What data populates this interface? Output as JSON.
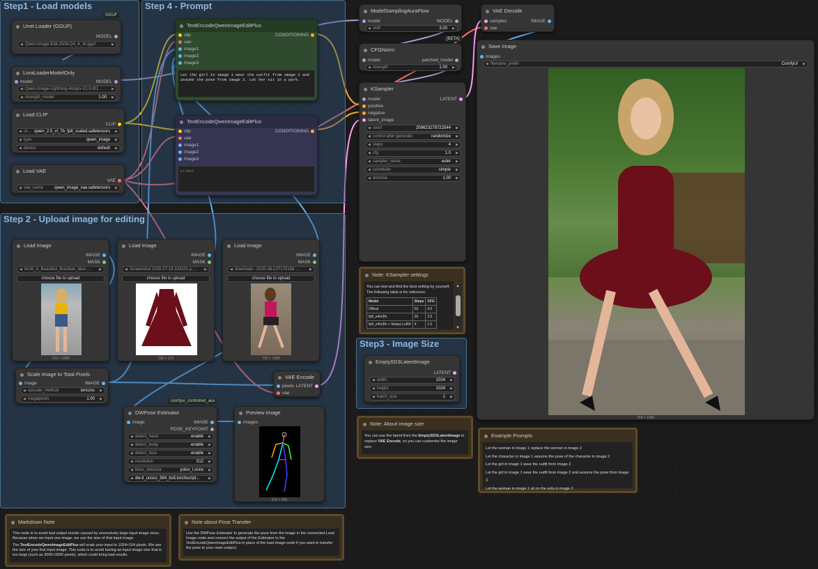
{
  "groups": {
    "g1": "Step1 - Load models",
    "g4": "Step 4 - Prompt",
    "g2": "Step 2 - Upload image for editing",
    "g3": "Step3 - Image Size"
  },
  "unet": {
    "title": "Unet Loader (GGUF)",
    "badge": "GGUF",
    "out": "MODEL",
    "file": "Qwen-Image-Edit-2509-Q4_K_M.gguf"
  },
  "lora": {
    "title": "LoraLoaderModelOnly",
    "in": "model",
    "out": "MODEL",
    "name": "Qwen-Image-Lightning-4steps-V1.0-bf1 ...",
    "strength_label": "strength_model",
    "strength": "1.00"
  },
  "clip": {
    "title": "Load CLIP",
    "out": "CLIP",
    "n_label": "cli...",
    "n_value": "qwen_2.5_vl_7b_fp8_scaled.safetensors",
    "type_label": "type",
    "type_value": "qwen_image",
    "device_label": "device",
    "device_value": "default"
  },
  "vae": {
    "title": "Load VAE",
    "out": "VAE",
    "label": "vae_name",
    "value": "qwen_image_vae.safetensors"
  },
  "te1": {
    "title": "TextEncodeQwenImageEditPlus",
    "out": "CONDITIONING",
    "inputs": [
      "clip",
      "vae",
      "image1",
      "image2",
      "image3"
    ],
    "text": "Let the girl in image 1 wear the outfit from image 2 and assume the pose from image 3. Let her sit in a park."
  },
  "te2": {
    "title": "TextEncodeQwenImageEditPlus",
    "out": "CONDITIONING",
    "inputs": [
      "clip",
      "vae",
      "image1",
      "image2",
      "image3"
    ],
    "placeholder": "prompt"
  },
  "msaf": {
    "title": "ModelSamplingAuraFlow",
    "in": "model",
    "out": "MODEL",
    "shift_label": "shift",
    "shift": "3.00",
    "beta": "[BETA]"
  },
  "cfgn": {
    "title": "CFGNorm",
    "in": "model",
    "out": "patched_model",
    "label": "strength",
    "value": "1.00"
  },
  "ks": {
    "title": "KSampler",
    "inputs": [
      "model",
      "positive",
      "negative",
      "latent_image"
    ],
    "out": "LATENT",
    "widgets": [
      [
        "seed",
        "209623278722544"
      ],
      [
        "control after generate",
        "randomize"
      ],
      [
        "steps",
        "4"
      ],
      [
        "cfg",
        "1.0"
      ],
      [
        "sampler_name",
        "euler"
      ],
      [
        "scheduler",
        "simple"
      ],
      [
        "denoise",
        "1.00"
      ]
    ]
  },
  "vaed": {
    "title": "VAE Decode",
    "inputs": [
      "samples",
      "vae"
    ],
    "out": "IMAGE"
  },
  "save": {
    "title": "Save Image",
    "in": "images",
    "prefix_label": "filename_prefix",
    "prefix": "ComfyUI",
    "caption": "768 × 1360"
  },
  "li1": {
    "title": "Load Image",
    "outs": [
      "IMAGE",
      "MASK"
    ],
    "file": "9x16_A_Beautiful_Brazilian_blon ...",
    "button": "choose file to upload",
    "caption": "720 × 1280"
  },
  "li2": {
    "title": "Load Image",
    "outs": [
      "IMAGE",
      "MASK"
    ],
    "file": "Screenshot 2025-07-18 224101.p ...",
    "button": "choose file to upload",
    "caption": "228 × 272"
  },
  "li3": {
    "title": "Load Image",
    "outs": [
      "IMAGE",
      "MASK"
    ],
    "file": "download - 2025-08-13T170156. ...",
    "button": "choose file to upload",
    "caption": "720 × 1280"
  },
  "scale": {
    "title": "Scale Image to Total Pixels",
    "in": "image",
    "out": "IMAGE",
    "m_label": "upscale_method",
    "m_value": "lanczos",
    "mp_label": "megapixels",
    "mp_value": "1.00"
  },
  "vaee": {
    "title": "VAE Encode",
    "inputs": [
      "pixels",
      "vae"
    ],
    "out": "LATENT"
  },
  "dw": {
    "title": "DWPose Estimator",
    "badge": "comfyui_controlnet_aux",
    "in": "image",
    "outs": [
      "IMAGE",
      "POSE_KEYPOINT"
    ],
    "widgets": [
      [
        "detect_hand",
        "enable"
      ],
      [
        "detect_body",
        "enable"
      ],
      [
        "detect_face",
        "enable"
      ],
      [
        "resolution",
        "512"
      ],
      [
        "bbox_detector",
        "yolox_l.onnx"
      ],
      [
        "",
        "dw-ll_ucoco_384_bs5.torchscript..."
      ]
    ]
  },
  "prev": {
    "title": "Preview Image",
    "in": "images",
    "caption": "512 × 910"
  },
  "empty": {
    "title": "EmptySD3LatentImage",
    "out": "LATENT",
    "widgets": [
      [
        "width",
        "1024"
      ],
      [
        "height",
        "1024"
      ],
      [
        "batch_size",
        "1"
      ]
    ]
  },
  "note_ks": {
    "title": "Note: KSampler settings",
    "text": "You can test and find the best setting by yourself. The following table is for reference.",
    "headers": [
      "Model",
      "Steps",
      "CFG"
    ],
    "rows": [
      [
        "Offical",
        "50",
        "4.0"
      ],
      [
        "fp8_e4m3fn",
        "20",
        "2.5"
      ],
      [
        "fp8_e4m3fn + 4steps LoRA",
        "4",
        "1.0"
      ]
    ]
  },
  "note_size": {
    "title": "Note: About image size",
    "pre": "You can use the latent from the ",
    "b1": "EmptySD3LatentImage",
    "mid": " to replace ",
    "b2": "VAE Encode",
    "post": ", so you can customize the image size."
  },
  "examples": {
    "title": "Example Prompts",
    "lines": [
      "Let the woman in image 1 replace the woman in image 2",
      "Let the character in image 1 assume the pose of the character in image 2",
      "Let the girl in image 1 wear the outfit from image 2",
      "Let the girl in image 1 wear the outfit from image 2 and assume the pose from image 3",
      "Let the woman in image 1 sit on the sofa in image 2"
    ]
  },
  "md": {
    "title": "Markdown Note",
    "p1": "This node is to avoid bad output results caused by excessively large input image sizes. Because when we input one image, we use the size of that input image.",
    "b": "TextEncodeQwenImageEditPlus",
    "p2": " will scale your input to 1024×104 pixels. We use the size of your first input image. This node is to avoid having an input image size that is too large (such as 3000×3000 pixels), which could bring bad results.",
    "pre": "The "
  },
  "pose_note": {
    "title": "Note about Pose Transfer",
    "text": "Use the DWPose Estimator to generate the pose from the image in the connected Load Image node and connect the output of the Estimator to the TextEncodeQwenImageEditPlus in place of the load image node if you want to transfer the pose to your main subject."
  },
  "colors": {
    "model": "#b39ddb",
    "clip": "#ffd500",
    "vae": "#ff6e6e",
    "image": "#64b5f6",
    "cond": "#ffa931",
    "latent": "#ff9cf9"
  }
}
